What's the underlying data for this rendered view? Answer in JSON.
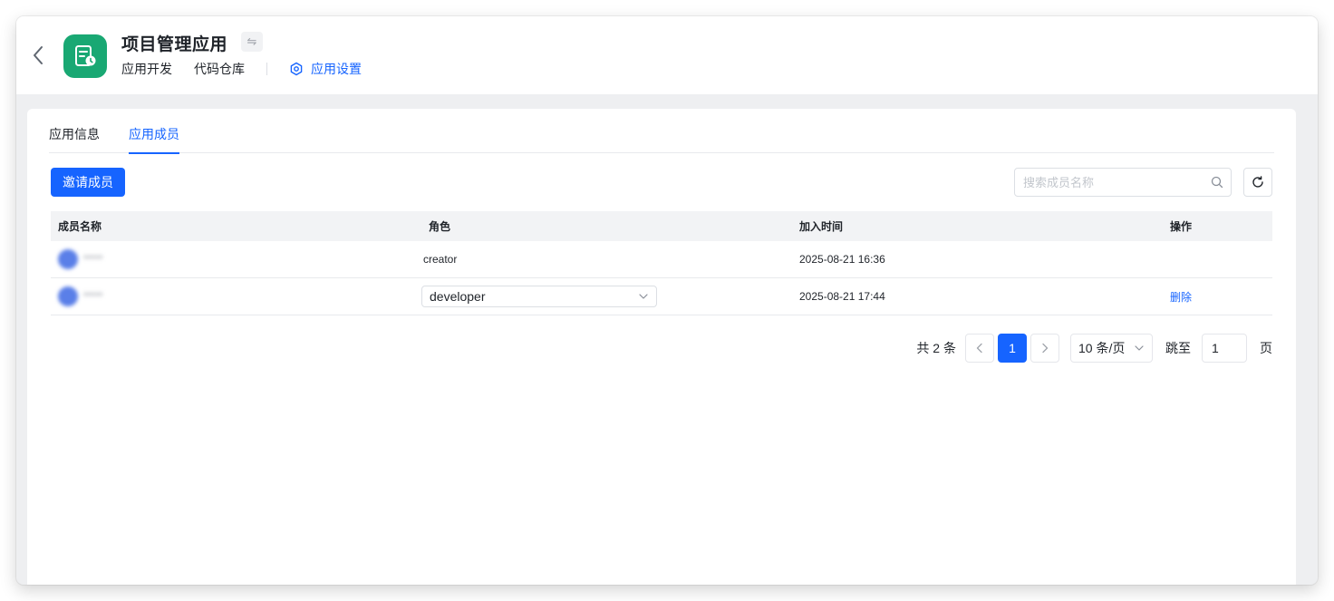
{
  "header": {
    "app_title": "项目管理应用",
    "switch_glyph": "⇋",
    "nav": {
      "dev": "应用开发",
      "repo": "代码仓库",
      "settings": "应用设置"
    }
  },
  "tabs": [
    {
      "label": "应用信息",
      "active": false
    },
    {
      "label": "应用成员",
      "active": true
    }
  ],
  "toolbar": {
    "invite_label": "邀请成员",
    "search_placeholder": "搜索成员名称"
  },
  "table": {
    "columns": [
      "成员名称",
      "角色",
      "加入时间",
      "操作"
    ],
    "rows": [
      {
        "name": "*****",
        "role": "creator",
        "role_editable": false,
        "joined": "2025-08-21 16:36",
        "action": ""
      },
      {
        "name": "*****",
        "role": "developer",
        "role_editable": true,
        "joined": "2025-08-21 17:44",
        "action": "删除"
      }
    ]
  },
  "pagination": {
    "total_text": "共 2 条",
    "current_page": "1",
    "page_size": "10 条/页",
    "jump_label": "跳至",
    "jump_value": "1",
    "page_suffix": "页"
  },
  "colors": {
    "accent": "#1664ff",
    "logo_bg": "#19a873"
  }
}
